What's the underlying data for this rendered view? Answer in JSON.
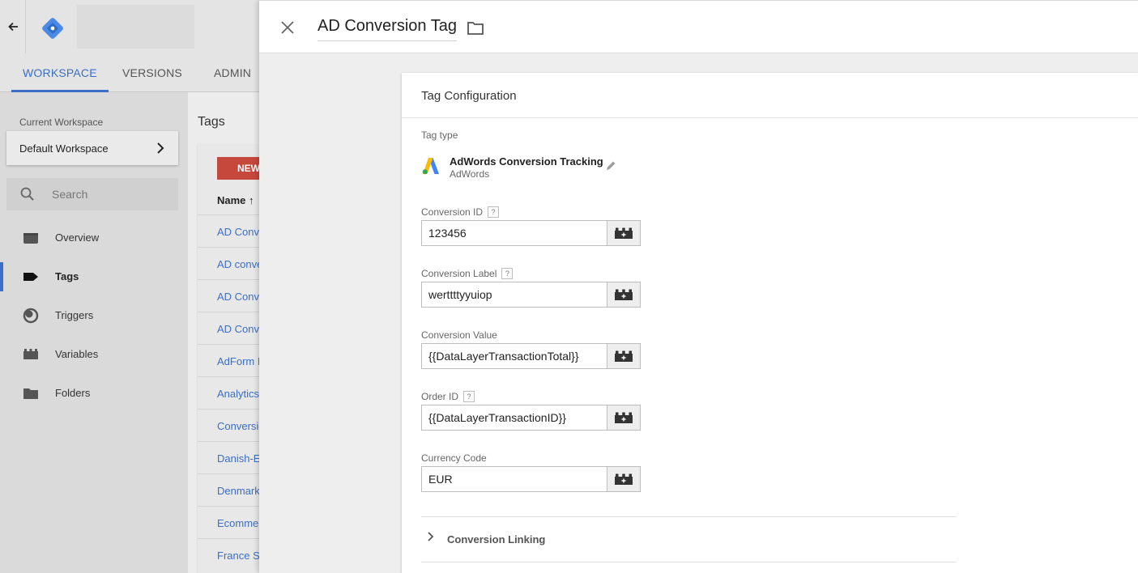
{
  "header": {
    "back_icon": "arrow-left-icon",
    "logo": "gtm-logo"
  },
  "nav_tabs": [
    {
      "label": "WORKSPACE",
      "active": true
    },
    {
      "label": "VERSIONS",
      "active": false
    },
    {
      "label": "ADMIN",
      "active": false
    }
  ],
  "sidebar": {
    "workspace_label": "Current Workspace",
    "workspace_name": "Default Workspace",
    "search_placeholder": "Search",
    "items": [
      {
        "label": "Overview",
        "icon": "overview-icon",
        "active": false
      },
      {
        "label": "Tags",
        "icon": "tag-icon",
        "active": true
      },
      {
        "label": "Triggers",
        "icon": "trigger-icon",
        "active": false
      },
      {
        "label": "Variables",
        "icon": "variables-icon",
        "active": false
      },
      {
        "label": "Folders",
        "icon": "folder-icon",
        "active": false
      }
    ]
  },
  "tags_list": {
    "title": "Tags",
    "new_button": "NEW",
    "name_header": "Name ↑",
    "rows": [
      "AD Conve",
      "AD conve",
      "AD Conve",
      "AD Conve",
      "AdForm I",
      "Analytics",
      "Conversio",
      "Danish-Ei",
      "Denmark",
      "Ecomme",
      "France Si"
    ]
  },
  "panel": {
    "title": "AD Conversion Tag",
    "close_icon": "close-icon",
    "folder_icon": "folder-icon",
    "card_title": "Tag Configuration",
    "tag_type_label": "Tag type",
    "tag_type_name": "AdWords Conversion Tracking",
    "tag_type_sub": "AdWords",
    "fields": [
      {
        "label": "Conversion ID",
        "value": "123456",
        "help": true
      },
      {
        "label": "Conversion Label",
        "value": "werttttyyuiop",
        "help": true
      },
      {
        "label": "Conversion Value",
        "value": "{{DataLayerTransactionTotal}}",
        "help": false
      },
      {
        "label": "Order ID",
        "value": "{{DataLayerTransactionID}}",
        "help": true
      },
      {
        "label": "Currency Code",
        "value": "EUR",
        "help": false
      }
    ],
    "help_glyph": "?",
    "linking_label": "Conversion Linking"
  },
  "colors": {
    "accent": "#3b6ec6",
    "new_button": "#c6473b",
    "adwords_blue": "#4285f4",
    "adwords_yellow": "#fbbc04",
    "adwords_green": "#34a853"
  }
}
